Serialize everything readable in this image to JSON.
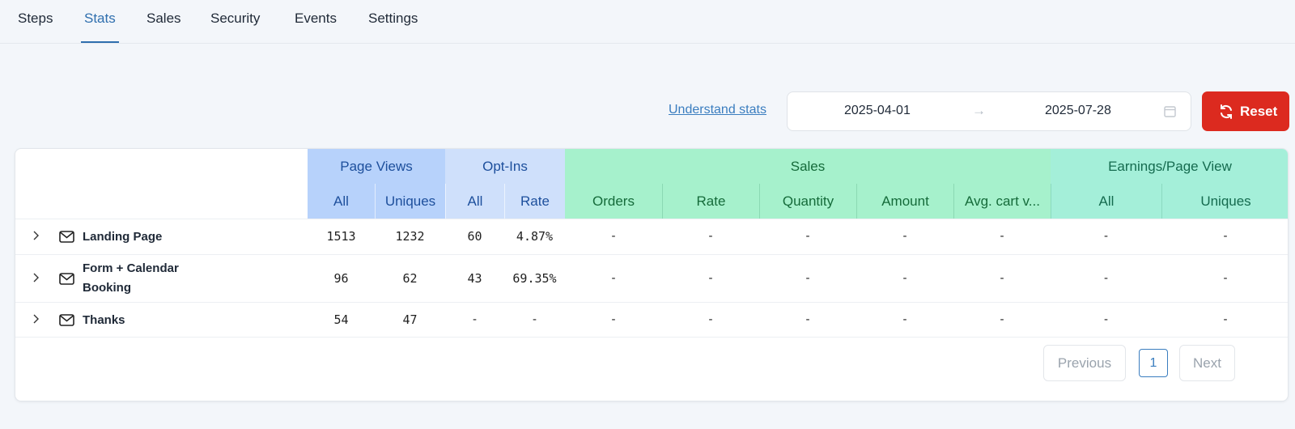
{
  "tabs": [
    {
      "label": "Steps",
      "active": false
    },
    {
      "label": "Stats",
      "active": true
    },
    {
      "label": "Sales",
      "active": false
    },
    {
      "label": "Security",
      "active": false
    },
    {
      "label": "Events",
      "active": false
    },
    {
      "label": "Settings",
      "active": false
    }
  ],
  "toolbar": {
    "understand_link": "Understand stats",
    "date_start": "2025-04-01",
    "date_end": "2025-07-28",
    "reset_label": "Reset"
  },
  "table": {
    "groups": {
      "page_views": "Page Views",
      "opt_ins": "Opt-Ins",
      "sales": "Sales",
      "earnings": "Earnings/Page View"
    },
    "columns": {
      "pv_all": "All",
      "pv_uniques": "Uniques",
      "oi_all": "All",
      "oi_rate": "Rate",
      "orders": "Orders",
      "rate": "Rate",
      "quantity": "Quantity",
      "amount": "Amount",
      "avg_cart": "Avg. cart v...",
      "ep_all": "All",
      "ep_uniques": "Uniques"
    },
    "rows": [
      {
        "name_line1": "Landing Page",
        "name_line2": "",
        "pv_all": "1513",
        "pv_uniques": "1232",
        "oi_all": "60",
        "oi_rate": "4.87%",
        "orders": "-",
        "rate": "-",
        "quantity": "-",
        "amount": "-",
        "avg_cart": "-",
        "ep_all": "-",
        "ep_uniques": "-"
      },
      {
        "name_line1": "Form + Calendar",
        "name_line2": "Booking",
        "pv_all": "96",
        "pv_uniques": "62",
        "oi_all": "43",
        "oi_rate": "69.35%",
        "orders": "-",
        "rate": "-",
        "quantity": "-",
        "amount": "-",
        "avg_cart": "-",
        "ep_all": "-",
        "ep_uniques": "-"
      },
      {
        "name_line1": "Thanks",
        "name_line2": "",
        "pv_all": "54",
        "pv_uniques": "47",
        "oi_all": "-",
        "oi_rate": "-",
        "orders": "-",
        "rate": "-",
        "quantity": "-",
        "amount": "-",
        "avg_cart": "-",
        "ep_all": "-",
        "ep_uniques": "-"
      }
    ]
  },
  "pagination": {
    "previous": "Previous",
    "page": "1",
    "next": "Next"
  },
  "colors": {
    "accent": "#2f6fae",
    "reset": "#dc2a1f",
    "page_views_header": "#b7d2fb",
    "opt_ins_header": "#cfe0fb",
    "sales_header": "#a6f1cc",
    "earnings_header": "#a4efd9"
  },
  "icons": {
    "row_icon": "mail-icon",
    "expand": "chevron-right-icon",
    "calendar": "calendar-icon",
    "reset": "refresh-icon",
    "arrow": "arrow-right-icon"
  }
}
